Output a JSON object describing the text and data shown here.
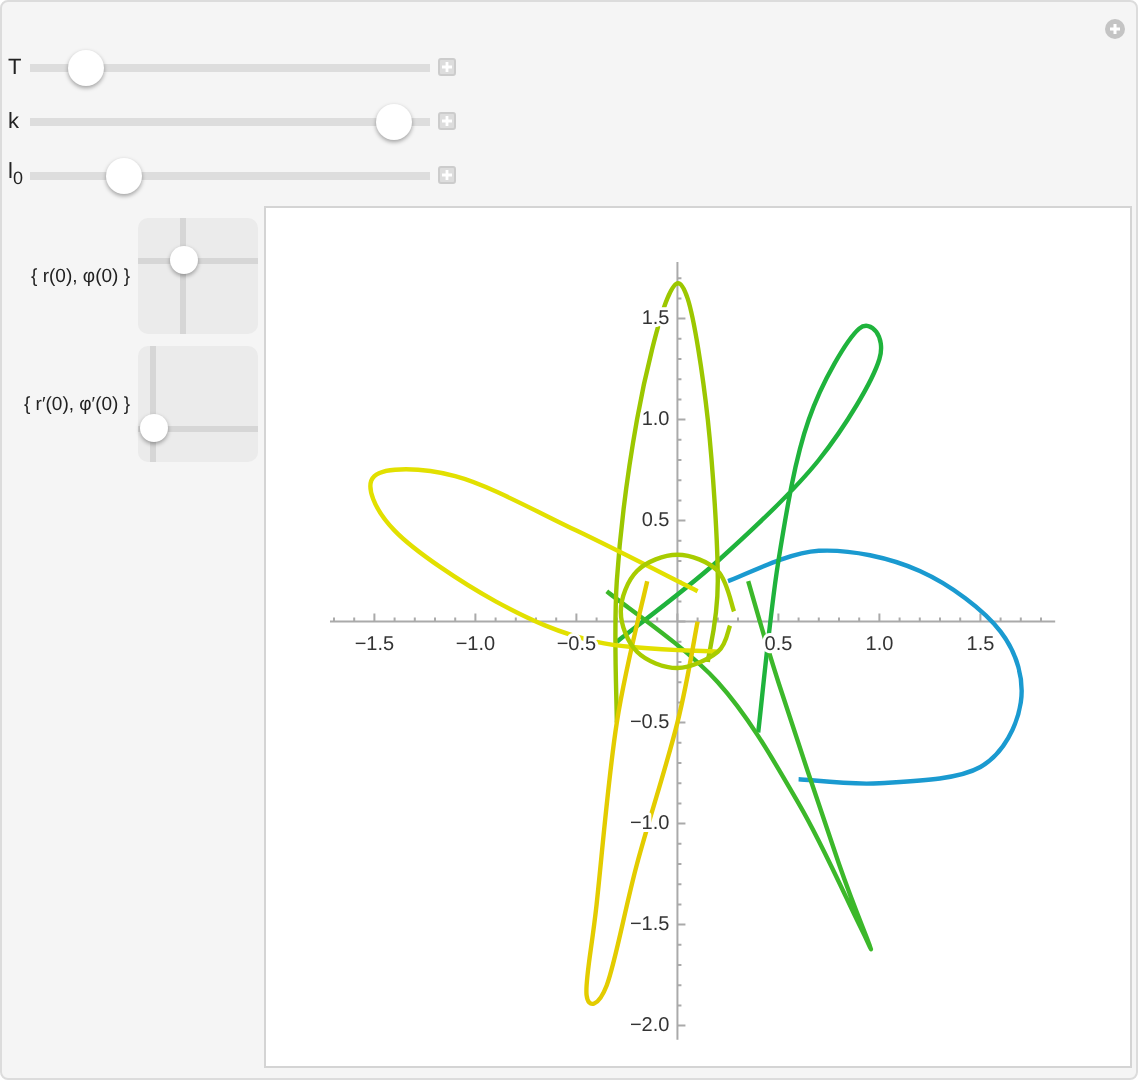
{
  "sliders": [
    {
      "label": "T",
      "level": 0.14
    },
    {
      "label": "k",
      "level": 0.91
    },
    {
      "label": "l$_{0}$",
      "level": 0.235
    }
  ],
  "pads": [
    {
      "label": "{ r(0), φ(0) }",
      "x": {
        "level": 0.38
      },
      "y": {
        "level": 0.63
      }
    },
    {
      "label": "{ r′(0), φ′(0) }",
      "x": {
        "level": 0.13
      },
      "y": {
        "level": 0.29
      }
    }
  ],
  "plot": {
    "chart_data": {
      "type": "line",
      "xlim": [
        -1.72,
        1.87
      ],
      "ylim": [
        -2.07,
        1.78
      ],
      "xticks": [
        {
          "value": -1.5,
          "label": "−1.5"
        },
        {
          "value": -1.0,
          "label": "−1.0"
        },
        {
          "value": -0.5,
          "label": "−0.5"
        },
        {
          "value": 0.5,
          "label": "0.5"
        },
        {
          "value": 1.0,
          "label": "1.0"
        },
        {
          "value": 1.5,
          "label": "1.5"
        }
      ],
      "yticks": [
        {
          "value": -2.0,
          "label": "−2.0"
        },
        {
          "value": -1.5,
          "label": "−1.5"
        },
        {
          "value": -1.0,
          "label": "−1.0"
        },
        {
          "value": -0.5,
          "label": "−0.5"
        },
        {
          "value": 0.5,
          "label": "0.5"
        },
        {
          "value": 1.0,
          "label": "1.0"
        },
        {
          "value": 1.5,
          "label": "1.5"
        }
      ],
      "series": [
        {
          "color": "#1a9ad0",
          "x": [
            0.25,
            0.7,
            1.2,
            1.6,
            1.7,
            1.5,
            1.0,
            0.6
          ],
          "values": [
            0.2,
            0.35,
            0.25,
            -0.05,
            -0.4,
            -0.72,
            -0.8,
            -0.78
          ]
        },
        {
          "color": "#1fb33c",
          "x": [
            0.4,
            0.5,
            0.65,
            0.9,
            1.0,
            0.7,
            0.2,
            -0.3
          ],
          "values": [
            -0.55,
            0.3,
            1.0,
            1.45,
            1.3,
            0.8,
            0.3,
            -0.1
          ]
        },
        {
          "color": "#3cb82a",
          "x": [
            -0.35,
            0.2,
            0.6,
            0.9,
            0.95,
            0.8,
            0.5,
            0.35
          ],
          "values": [
            0.15,
            -0.3,
            -0.9,
            -1.5,
            -1.6,
            -1.2,
            -0.3,
            0.2
          ]
        },
        {
          "color": "#9cc700",
          "x": [
            -0.3,
            -0.3,
            -0.2,
            -0.05,
            0.05,
            0.15,
            0.2,
            0.15
          ],
          "values": [
            -0.5,
            0.2,
            1.0,
            1.6,
            1.6,
            1.0,
            0.2,
            -0.2
          ]
        },
        {
          "color": "#e2e000",
          "x": [
            0.1,
            -0.5,
            -1.1,
            -1.5,
            -1.4,
            -0.9,
            -0.4,
            0.2
          ],
          "values": [
            0.15,
            0.45,
            0.72,
            0.72,
            0.45,
            0.1,
            -0.1,
            -0.15
          ]
        },
        {
          "color": "#e3cc00",
          "x": [
            -0.15,
            -0.3,
            -0.4,
            -0.45,
            -0.35,
            -0.2,
            0.0,
            0.1
          ],
          "values": [
            0.2,
            -0.5,
            -1.4,
            -1.85,
            -1.8,
            -1.2,
            -0.5,
            0.0
          ]
        },
        {
          "color": "#a8cc00",
          "x": [
            0.28,
            0.2,
            0,
            -0.2,
            -0.28,
            -0.2,
            0,
            0.2,
            0.26
          ],
          "values": [
            0.05,
            0.25,
            0.33,
            0.25,
            0.05,
            -0.15,
            -0.23,
            -0.15,
            -0.02
          ]
        }
      ]
    }
  }
}
